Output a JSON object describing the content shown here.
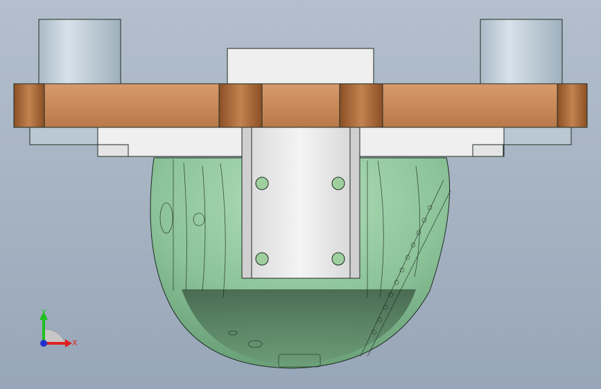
{
  "viewport": {
    "background_top": "#b3bfcc",
    "background_bottom": "#97a6b8"
  },
  "model": {
    "flange_color": "#c98a5a",
    "flange_dark": "#9c5a2e",
    "post_color": "#b9c8d3",
    "bracket_color": "#ececec",
    "block_color": "#f0f0f0",
    "dome_color": "#8fc79a",
    "dome_dark": "#4a6f55",
    "edge_color": "#1d2a22"
  },
  "triad": {
    "x_label": "X",
    "y_label": "Y",
    "x_color": "#e02020",
    "y_color": "#20c020",
    "z_color": "#2030d0",
    "icons": [
      "x-axis-arrow-icon",
      "y-axis-arrow-icon",
      "z-axis-dot-icon"
    ]
  }
}
